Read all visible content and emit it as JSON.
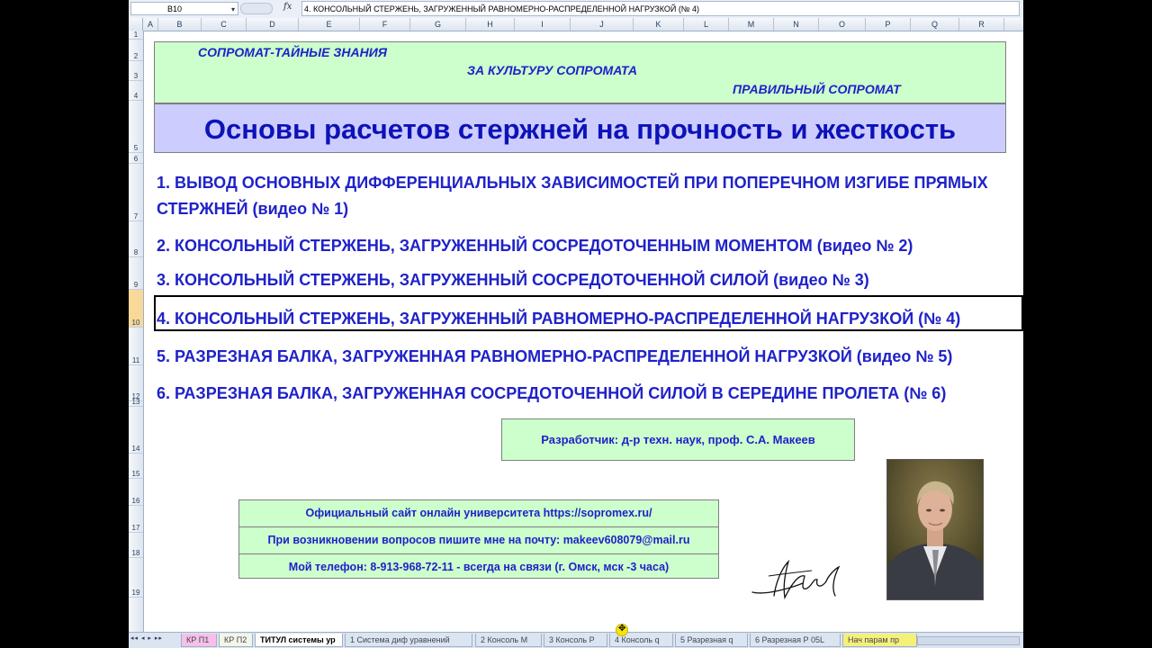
{
  "formula_bar": {
    "name_box": "B10",
    "name_box_extra": "",
    "fx": "fx",
    "content": "4. КОНСОЛЬНЫЙ СТЕРЖЕНЬ, ЗАГРУЖЕННЫЙ РАВНОМЕРНО-РАСПРЕДЕЛЕННОЙ НАГРУЗКОЙ (№ 4)"
  },
  "columns": [
    "A",
    "B",
    "C",
    "D",
    "E",
    "F",
    "G",
    "H",
    "I",
    "J",
    "K",
    "L",
    "M",
    "N",
    "O",
    "P",
    "Q",
    "R"
  ],
  "rows": [
    "1",
    "2",
    "3",
    "4",
    "5",
    "6",
    "7",
    "8",
    "9",
    "10",
    "11",
    "12",
    "13",
    "14",
    "15",
    "16",
    "17",
    "18",
    "19"
  ],
  "banner": {
    "line1": "СОПРОМАТ-ТАЙНЫЕ ЗНАНИЯ",
    "line2": "ЗА КУЛЬТУРУ СОПРОМАТА",
    "line3": "ПРАВИЛЬНЫЙ СОПРОМАТ"
  },
  "title": "Основы расчетов стержней на прочность и жесткость",
  "menu_items": [
    "1. ВЫВОД ОСНОВНЫХ ДИФФЕРЕНЦИАЛЬНЫХ ЗАВИСИМОСТЕЙ ПРИ ПОПЕРЕЧНОМ ИЗГИБЕ ПРЯМЫХ СТЕРЖНЕЙ (видео № 1)",
    "2. КОНСОЛЬНЫЙ СТЕРЖЕНЬ, ЗАГРУЖЕННЫЙ СОСРЕДОТОЧЕННЫМ МОМЕНТОМ (видео № 2)",
    "3. КОНСОЛЬНЫЙ СТЕРЖЕНЬ, ЗАГРУЖЕННЫЙ СОСРЕДОТОЧЕННОЙ СИЛОЙ (видео № 3)",
    "4. КОНСОЛЬНЫЙ СТЕРЖЕНЬ, ЗАГРУЖЕННЫЙ РАВНОМЕРНО-РАСПРЕДЕЛЕННОЙ НАГРУЗКОЙ (№ 4)",
    "5. РАЗРЕЗНАЯ БАЛКА, ЗАГРУЖЕННАЯ РАВНОМЕРНО-РАСПРЕДЕЛЕННОЙ НАГРУЗКОЙ (видео № 5)",
    "6. РАЗРЕЗНАЯ БАЛКА, ЗАГРУЖЕННАЯ СОСРЕДОТОЧЕННОЙ СИЛОЙ В СЕРЕДИНЕ ПРОЛЕТА (№ 6)"
  ],
  "developer": "Разработчик: д-р техн. наук, проф. С.А. Макеев",
  "contacts": [
    "Официальный сайт онлайн университета https://sopromex.ru/",
    "При возникновении вопросов пишите мне на почту: makeev608079@mail.ru",
    "Мой телефон: 8-913-968-72-11  - всегда на связи (г. Омск, мск -3 часа)"
  ],
  "sheet_tabs": [
    {
      "label": "КР П1",
      "color": "#f6c0e8",
      "active": false
    },
    {
      "label": "КР П2",
      "color": "#f3f6e6",
      "active": false
    },
    {
      "label": "ТИТУЛ системы ур",
      "color": "#ffffff",
      "active": true
    },
    {
      "label": "1 Система диф уравнений",
      "color": "#dbe4f1",
      "active": false
    },
    {
      "label": "2 Консоль М",
      "color": "#dbe4f1",
      "active": false
    },
    {
      "label": "3 Консоль Р",
      "color": "#dbe4f1",
      "active": false
    },
    {
      "label": "4 Консоль q",
      "color": "#dbe4f1",
      "active": false
    },
    {
      "label": "5 Разрезная q",
      "color": "#dbe4f1",
      "active": false
    },
    {
      "label": "6 Разрезная Р 05L",
      "color": "#dbe4f1",
      "active": false
    },
    {
      "label": "Нач парам пр",
      "color": "#f5f07a",
      "active": false
    }
  ],
  "nav_arrows": "◂◂ ◂ ▸ ▸▸",
  "icons": [
    "fx-icon",
    "dropdown-arrow-icon",
    "signature-icon",
    "portrait-photo-icon",
    "cursor-icon"
  ],
  "colors": {
    "banner_bg": "#ccffcc",
    "title_bg": "#ccccff",
    "text_blue": "#1f22c8"
  }
}
